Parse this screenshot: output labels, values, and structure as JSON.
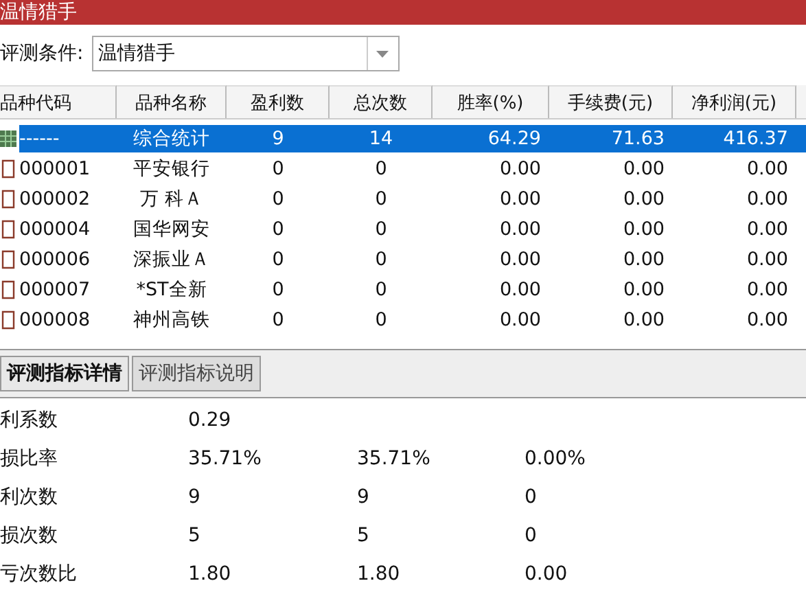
{
  "window": {
    "title": "温情猎手"
  },
  "condition": {
    "label": "评测条件:",
    "value": "温情猎手"
  },
  "table": {
    "columns": [
      "品种代码",
      "品种名称",
      "盈利数",
      "总次数",
      "胜率(%)",
      "手续费(元)",
      "净利润(元)"
    ],
    "rows": [
      {
        "kind": "summary",
        "selected": true,
        "cells": [
          "------",
          "综合统计",
          "9",
          "14",
          "64.29",
          "71.63",
          "416.37"
        ]
      },
      {
        "kind": "stock",
        "selected": false,
        "cells": [
          "000001",
          "平安银行",
          "0",
          "0",
          "0.00",
          "0.00",
          "0.00"
        ]
      },
      {
        "kind": "stock",
        "selected": false,
        "cells": [
          "000002",
          "万 科Ａ",
          "0",
          "0",
          "0.00",
          "0.00",
          "0.00"
        ]
      },
      {
        "kind": "stock",
        "selected": false,
        "cells": [
          "000004",
          "国华网安",
          "0",
          "0",
          "0.00",
          "0.00",
          "0.00"
        ]
      },
      {
        "kind": "stock",
        "selected": false,
        "cells": [
          "000006",
          "深振业Ａ",
          "0",
          "0",
          "0.00",
          "0.00",
          "0.00"
        ]
      },
      {
        "kind": "stock",
        "selected": false,
        "cells": [
          "000007",
          "*ST全新",
          "0",
          "0",
          "0.00",
          "0.00",
          "0.00"
        ]
      },
      {
        "kind": "stock",
        "selected": false,
        "cells": [
          "000008",
          "神州高铁",
          "0",
          "0",
          "0.00",
          "0.00",
          "0.00"
        ]
      }
    ]
  },
  "tabs": [
    {
      "label": "评测指标详情",
      "selected": true
    },
    {
      "label": "评测指标说明",
      "selected": false
    }
  ],
  "details": [
    {
      "label": "利系数",
      "values": [
        "0.29"
      ]
    },
    {
      "label": "损比率",
      "values": [
        "35.71%",
        "35.71%",
        "0.00%"
      ]
    },
    {
      "label": "利次数",
      "values": [
        "9",
        "9",
        "0"
      ]
    },
    {
      "label": "损次数",
      "values": [
        "5",
        "5",
        "0"
      ]
    },
    {
      "label": "亏次数比",
      "values": [
        "1.80",
        "1.80",
        "0.00"
      ]
    }
  ]
}
